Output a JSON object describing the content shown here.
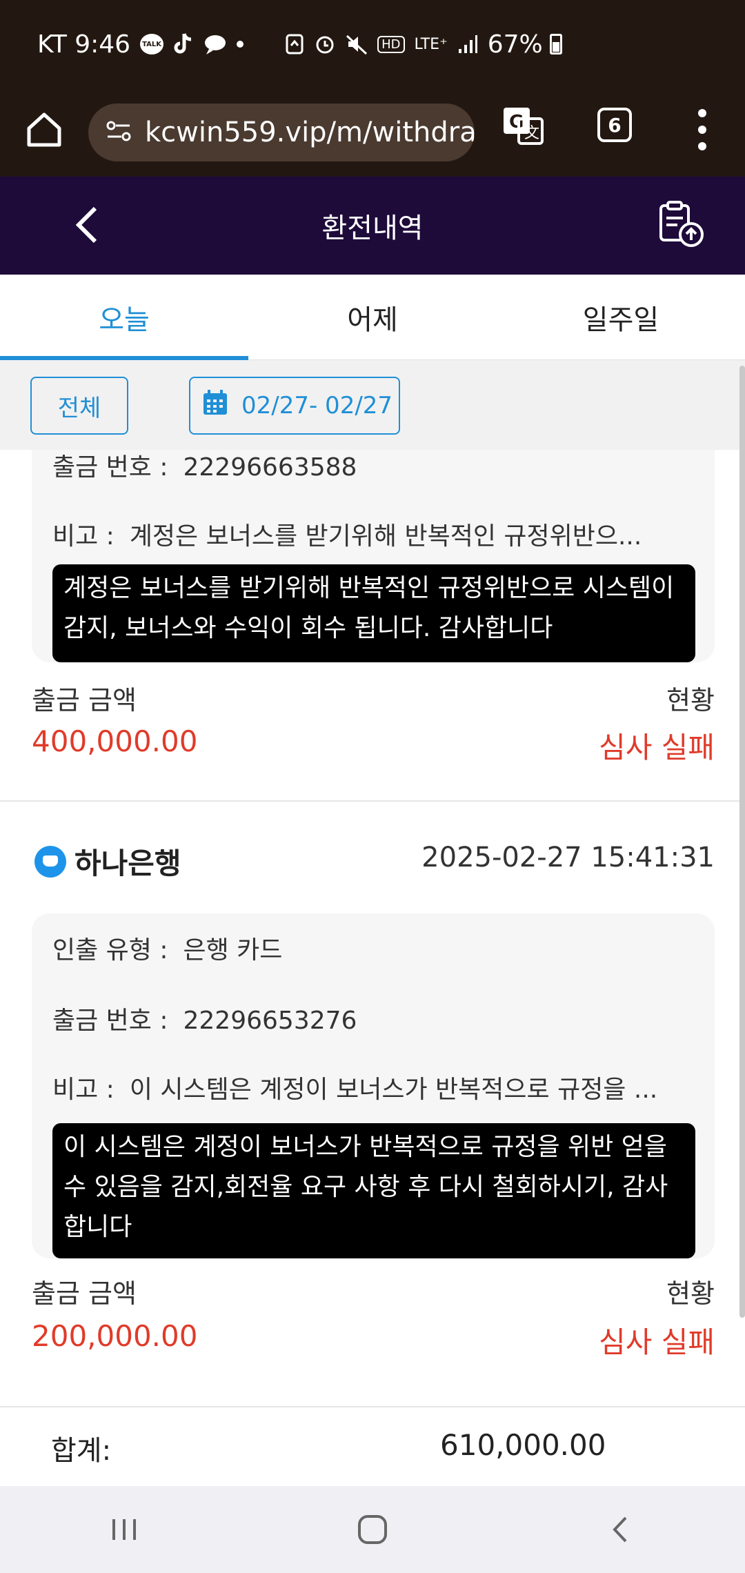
{
  "status_bar": {
    "carrier_time": "KT 9:46",
    "talk_label": "TALK",
    "hd_label": "HD",
    "lte_label": "LTE⁺",
    "battery": "67%"
  },
  "browser": {
    "url": "kcwin559.vip/m/withdra",
    "tab_count": "6"
  },
  "header": {
    "title": "환전내역"
  },
  "tabs": [
    {
      "label": "오늘",
      "active": true
    },
    {
      "label": "어제",
      "active": false
    },
    {
      "label": "일주일",
      "active": false
    }
  ],
  "filters": {
    "all_label": "전체",
    "date_range": "02/27- 02/27"
  },
  "records": [
    {
      "withdraw_no_label": "출금 번호 :",
      "withdraw_no": "22296663588",
      "remark_label": "비고 :",
      "remark_short": "계정은 보너스를 받기위해 반복적인 규정위반으...",
      "remark_full": "계정은 보너스를 받기위해 반복적인 규정위반으로 시스템이 감지, 보너스와 수익이 회수 됩니다. 감사합니다",
      "amount_label": "출금 금액",
      "amount": "400,000.00",
      "status_label": "현황",
      "status": "심사 실패"
    },
    {
      "bank": "하나은행",
      "datetime": "2025-02-27 15:41:31",
      "type_label": "인출 유형 :",
      "type": "은행 카드",
      "withdraw_no_label": "출금 번호 :",
      "withdraw_no": "22296653276",
      "remark_label": "비고 :",
      "remark_short": "이 시스템은 계정이 보너스가 반복적으로 규정을 ...",
      "remark_full": "이 시스템은 계정이 보너스가 반복적으로 규정을 위반 얻을 수 있음을 감지,회전율 요구 사항 후 다시 철회하시기, 감사합니다",
      "amount_label": "출금 금액",
      "amount": "200,000.00",
      "status_label": "현황",
      "status": "심사 실패"
    }
  ],
  "summary": {
    "label": "합계:",
    "total": "610,000.00"
  },
  "colors": {
    "status_bar_bg": "#231811",
    "header_bg": "#1e0b3a",
    "accent_blue": "#1f8fd6",
    "fail_red": "#e03b2a"
  },
  "icons": [
    "home-icon",
    "site-settings-icon",
    "translate-icon",
    "more-vert-icon",
    "back-chevron-icon",
    "clipboard-upload-icon",
    "calendar-icon",
    "bank-logo-icon",
    "recents-icon",
    "home-nav-icon",
    "back-nav-icon"
  ]
}
